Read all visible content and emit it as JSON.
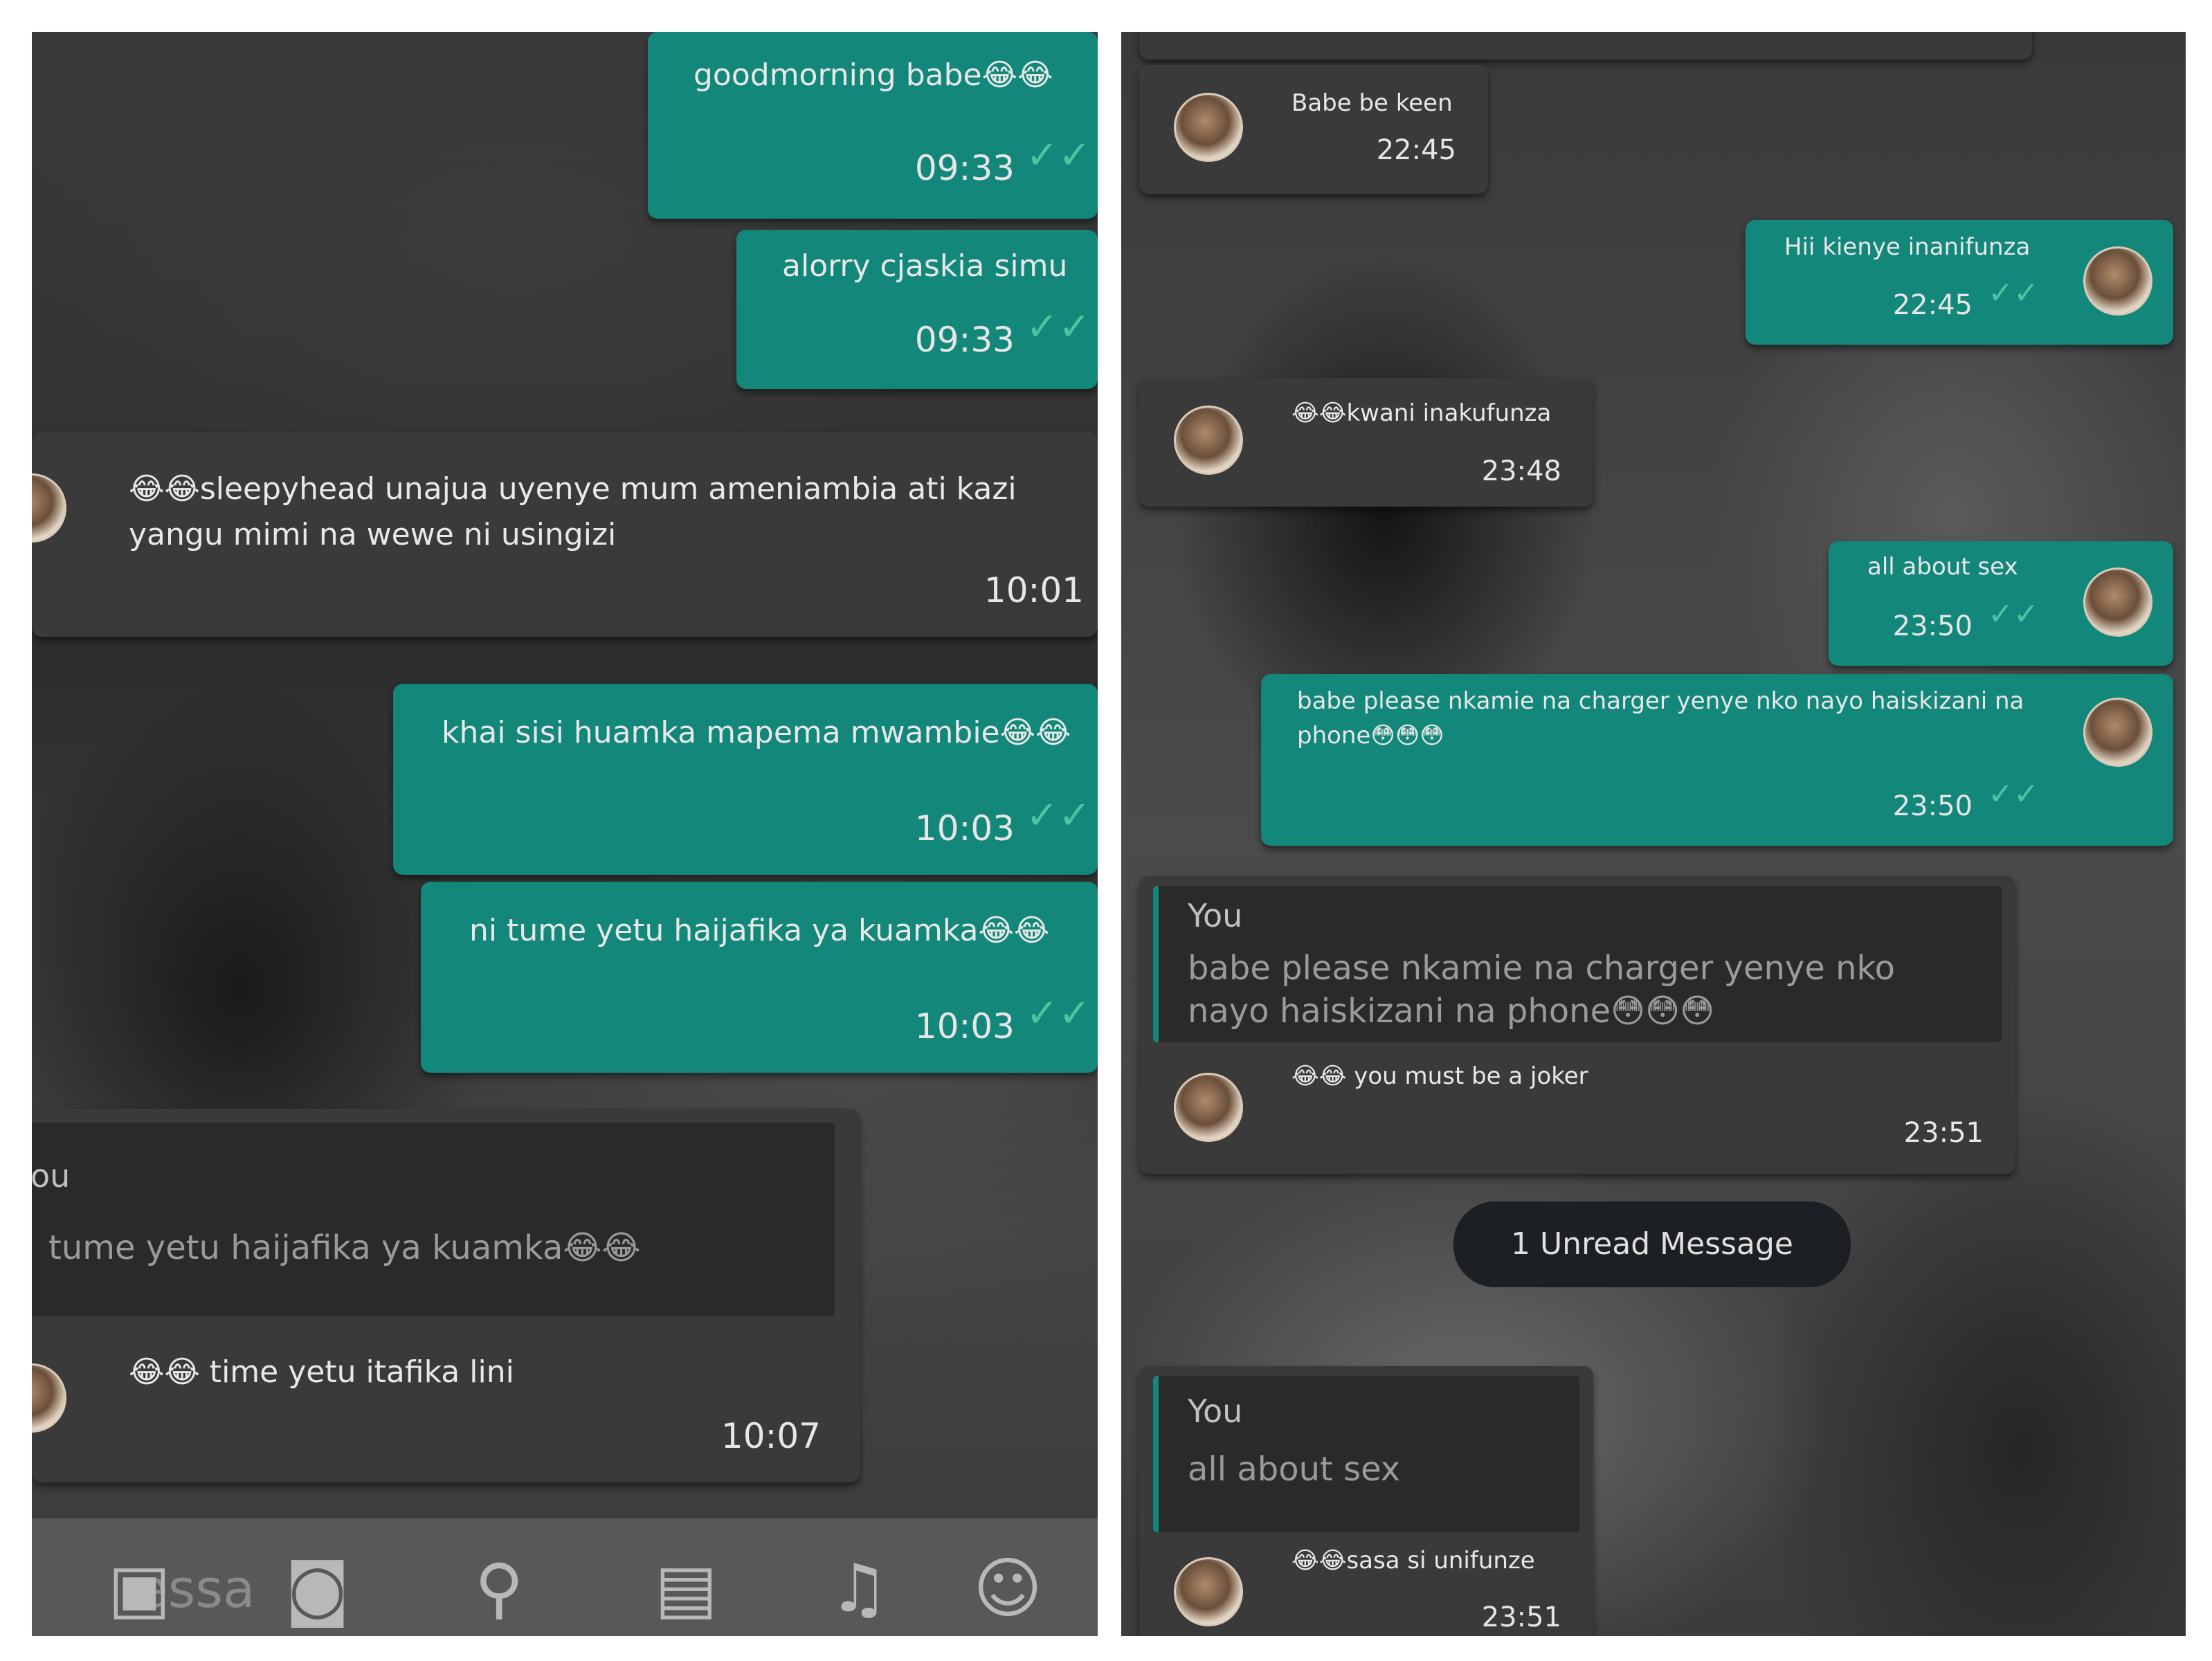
{
  "left": {
    "messages": [
      {
        "text": "goodmorning babe😂😂",
        "time": "09:33"
      },
      {
        "text": "alorry cjaskia simu",
        "time": "09:33"
      },
      {
        "text": "😂😂sleepyhead unajua uyenye mum ameniambia ati kazi yangu mimi na wewe ni usingizi",
        "time": "10:01"
      },
      {
        "text": "khai sisi huamka mapema mwambie😂😂",
        "time": "10:03"
      },
      {
        "text": "ni tume yetu haijafika ya kuamka😂😂",
        "time": "10:03"
      },
      {
        "quote_author": "ou",
        "quote_text": "tume yetu haijafika ya kuamka😂😂",
        "text": "😂😂 time yetu itafika lini",
        "time": "10:07"
      }
    ],
    "composer_hint": "essa",
    "icons": [
      "gallery-icon",
      "camera-icon",
      "location-icon",
      "contact-icon",
      "music-icon",
      "emoji-icon"
    ]
  },
  "right": {
    "messages": [
      {
        "text": "Babe be keen",
        "time": "22:45"
      },
      {
        "text": "Hii kienye inanifunza",
        "time": "22:45"
      },
      {
        "text": "😂😂kwani inakufunza",
        "time": "23:48"
      },
      {
        "text": "all about sex",
        "time": "23:50"
      },
      {
        "text": "babe please nkamie na charger yenye nko nayo haiskizani na phone😳😳😳",
        "time": "23:50"
      },
      {
        "quote_author": "You",
        "quote_text": "babe please nkamie na charger yenye nko nayo haiskizani na phone😳😳😳",
        "text": "😂😂 you must be a joker",
        "time": "23:51"
      },
      {
        "quote_author": "You",
        "quote_text": "all about sex",
        "text": "😂😂sasa si unifunze",
        "time": "23:51"
      }
    ],
    "unread_label": "1 Unread Message"
  },
  "ticks": "✓✓",
  "colors": {
    "outgoing": "#12877a",
    "incoming": "#3a3a3a",
    "tick": "#4fc3a1"
  }
}
